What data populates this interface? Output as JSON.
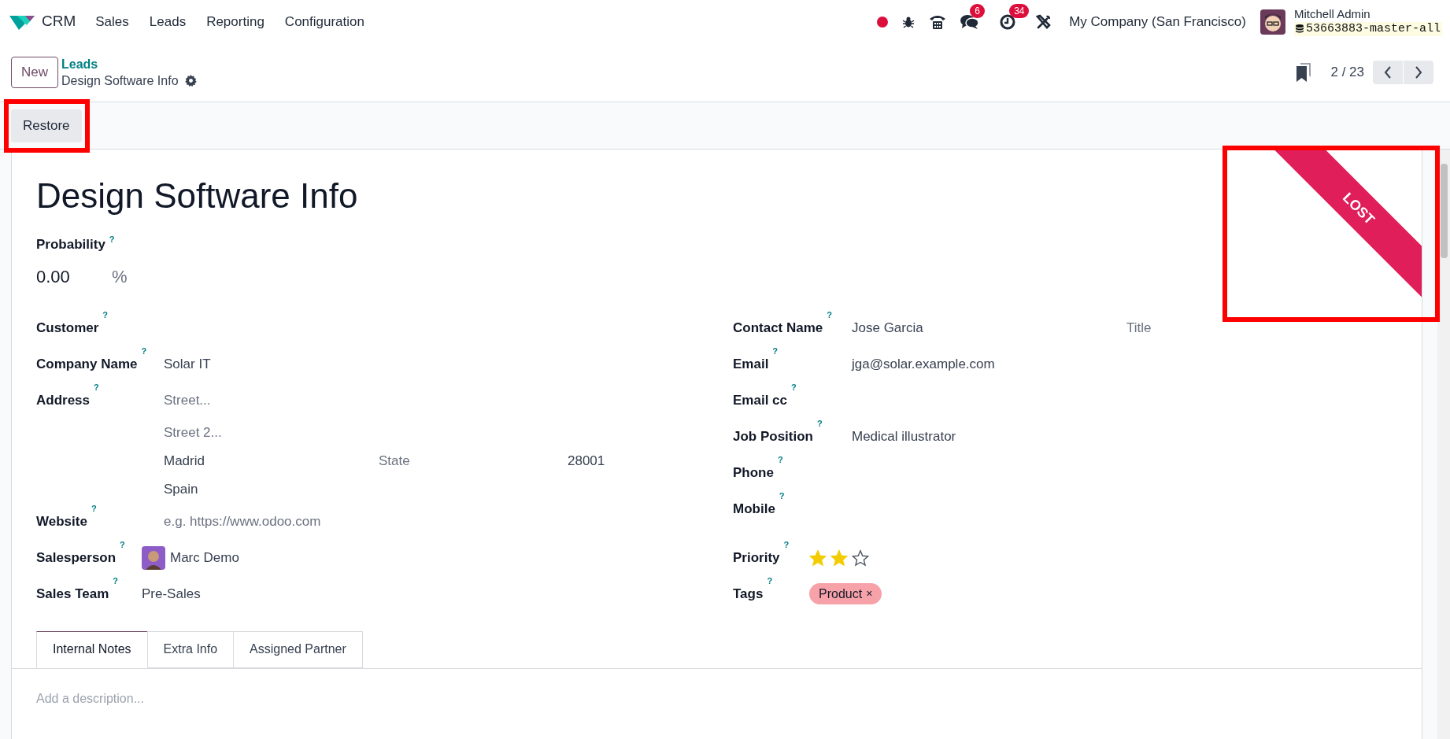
{
  "navbar": {
    "app": "CRM",
    "menu": [
      "Sales",
      "Leads",
      "Reporting",
      "Configuration"
    ],
    "systray": [
      {
        "kind": "record-dot"
      },
      {
        "kind": "bug"
      },
      {
        "kind": "phone"
      },
      {
        "kind": "chat",
        "badge": "6"
      },
      {
        "kind": "activity",
        "badge": "34"
      },
      {
        "kind": "tools"
      }
    ],
    "company": "My Company (San Francisco)",
    "user": "Mitchell Admin",
    "database": "53663883-master-all"
  },
  "control_panel": {
    "new_button": "New",
    "breadcrumb": "Leads",
    "record": "Design Software Info",
    "pager": "2 / 23"
  },
  "status_bar": {
    "buttons": [
      "Restore"
    ]
  },
  "ribbon": "LOST",
  "form": {
    "title": "Design Software Info",
    "probability": {
      "label": "Probability",
      "help": "?",
      "value": "0.00",
      "unit": "%"
    },
    "left": [
      {
        "kind": "text",
        "label": "Customer",
        "help": "?"
      },
      {
        "kind": "text",
        "label": "Company Name",
        "help": "?",
        "value": "Solar IT"
      },
      {
        "kind": "address",
        "label": "Address",
        "help": "?",
        "street": {
          "placeholder": "Street..."
        },
        "street2": {
          "placeholder": "Street 2..."
        },
        "city": "Madrid",
        "state": {
          "placeholder": "State"
        },
        "zip": "28001",
        "country": "Spain"
      },
      {
        "kind": "placeholder",
        "label": "Website",
        "help": "?",
        "placeholder": "e.g. https://www.odoo.com"
      }
    ],
    "team": [
      {
        "kind": "avatar",
        "label": "Salesperson",
        "help": "?",
        "value": "Marc Demo"
      },
      {
        "kind": "text",
        "label": "Sales Team",
        "help": "?",
        "value": "Pre-Sales"
      }
    ],
    "right": [
      {
        "kind": "contact",
        "label": "Contact Name",
        "help": "?",
        "value": "Jose Garcia",
        "title": {
          "placeholder": "Title"
        }
      },
      {
        "kind": "text",
        "label": "Email",
        "help": "?",
        "value": "jga@solar.example.com"
      },
      {
        "kind": "text",
        "label": "Email cc",
        "help": "?"
      },
      {
        "kind": "text",
        "label": "Job Position",
        "help": "?",
        "value": "Medical illustrator"
      },
      {
        "kind": "text",
        "label": "Phone",
        "help": "?"
      },
      {
        "kind": "text",
        "label": "Mobile",
        "help": "?"
      }
    ],
    "extra": [
      {
        "kind": "stars",
        "label": "Priority",
        "help": "?",
        "stars": 2
      },
      {
        "kind": "tags",
        "label": "Tags",
        "help": "?",
        "tags": [
          {
            "label": "Product",
            "remove": "×",
            "color": "#f7a1a8"
          }
        ]
      }
    ]
  },
  "tabs": [
    {
      "label": "Internal Notes",
      "selected": true
    },
    {
      "label": "Extra Info",
      "selected": false
    },
    {
      "label": "Assigned Partner",
      "selected": false
    }
  ],
  "description": {
    "placeholder": "Add a description..."
  }
}
